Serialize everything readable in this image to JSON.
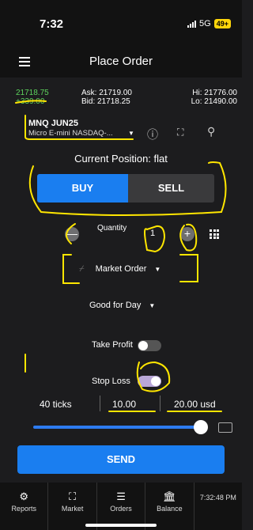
{
  "status": {
    "time": "7:32",
    "network": "5G",
    "battery": "49+"
  },
  "header": {
    "title": "Place Order"
  },
  "quote": {
    "last": "21718.75",
    "change": "+339.00",
    "ask": "Ask: 21719.00",
    "bid": "Bid: 21718.25",
    "hi": "Hi: 21776.00",
    "lo": "Lo: 21490.00"
  },
  "symbol": {
    "name": "MNQ JUN25",
    "description": "Micro E-mini NASDAQ-..."
  },
  "position": {
    "label": "Current Position:",
    "value": "flat"
  },
  "side": {
    "buy": "BUY",
    "sell": "SELL",
    "selected": "BUY"
  },
  "quantity": {
    "label": "Quantity",
    "value": "1",
    "minus": "—",
    "plus": "+"
  },
  "order_type": {
    "value": "Market Order"
  },
  "time_in_force": {
    "value": "Good for Day"
  },
  "take_profit": {
    "label": "Take Profit",
    "enabled": false
  },
  "stop_loss": {
    "label": "Stop Loss",
    "enabled": true,
    "ticks": "40 ticks",
    "price": "10.00",
    "usd": "20.00 usd",
    "slider_fraction": 0.95
  },
  "send": {
    "label": "SEND"
  },
  "tabs": [
    {
      "label": "Reports",
      "icon": "gear-icon"
    },
    {
      "label": "Market",
      "icon": "expand-icon"
    },
    {
      "label": "Orders",
      "icon": "list-icon"
    },
    {
      "label": "Balance",
      "icon": "bank-icon"
    },
    {
      "label": "7:32:48 PM",
      "icon": "clock"
    }
  ],
  "colors": {
    "accent": "#1a7ef0",
    "positive": "#5dd35d",
    "annotation": "#ffe600"
  }
}
